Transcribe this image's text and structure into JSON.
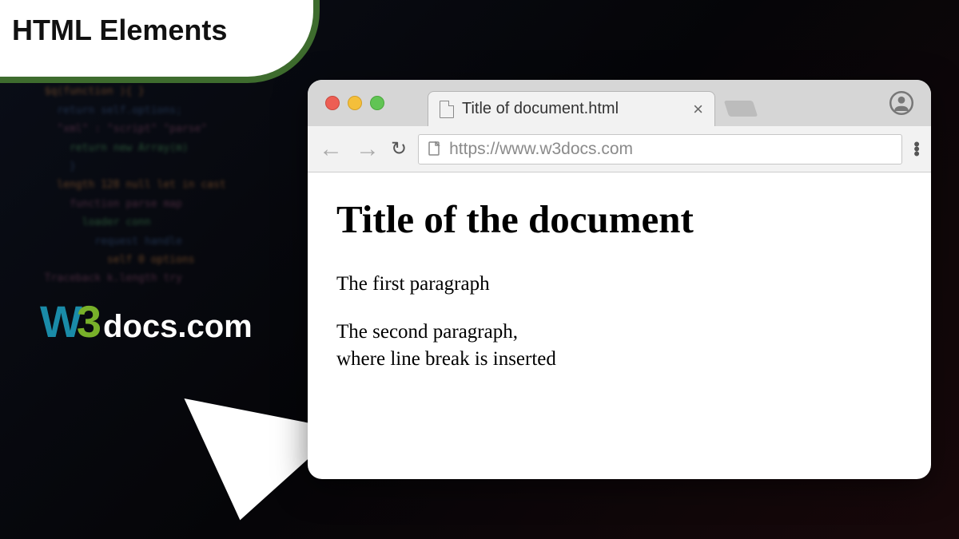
{
  "badge": {
    "title": "HTML Elements"
  },
  "logo": {
    "w": "W",
    "three": "3",
    "docs": "docs",
    "com": ".com"
  },
  "browser": {
    "tab_title": "Title of document.html",
    "url": "https://www.w3docs.com"
  },
  "page": {
    "heading": "Title of the document",
    "p1": "The first paragraph",
    "p2_line1": "The second paragraph,",
    "p2_line2": "where line break is inserted"
  }
}
